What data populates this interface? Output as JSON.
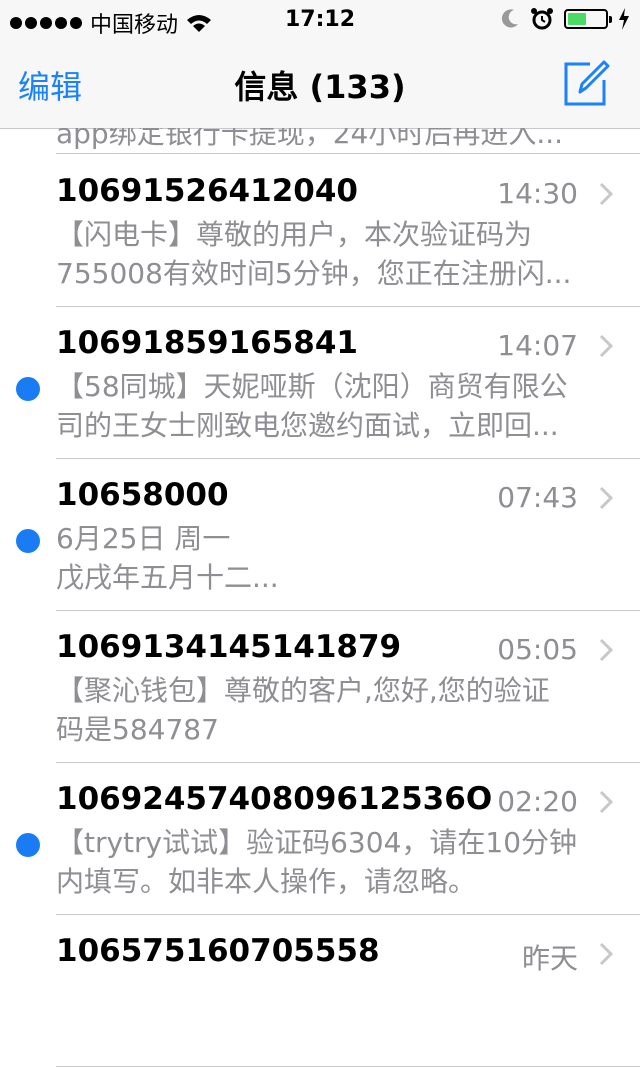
{
  "status_bar": {
    "carrier": "中国移动",
    "time": "17:12"
  },
  "nav": {
    "edit_label": "编辑",
    "title": "信息 (133)"
  },
  "clipped_preview": "app绑定银行卡提现，24小时后再进入...",
  "messages": [
    {
      "sender": "10691526412040",
      "time": "14:30",
      "line1": "【闪电卡】尊敬的用户，本次验证码为",
      "line2": "755008有效时间5分钟，您正在注册闪...",
      "unread": false
    },
    {
      "sender": "10691859165841",
      "time": "14:07",
      "line1": "【58同城】天妮哑斯（沈阳）商贸有限公",
      "line2": "司的王女士刚致电您邀约面试，立即回...",
      "unread": true
    },
    {
      "sender": "10658000",
      "time": "07:43",
      "line1": "6月25日 周一",
      "line2": "戊戌年五月十二...",
      "unread": true
    },
    {
      "sender": "1069134145141879",
      "time": "05:05",
      "line1": "【聚沁钱包】尊敬的客户,您好,您的验证",
      "line2": "码是584787",
      "unread": false
    },
    {
      "sender": "1069245740809612536O",
      "time": "02:20",
      "line1": "【trytry试试】验证码6304，请在10分钟",
      "line2": "内填写。如非本人操作，请忽略。",
      "unread": true
    },
    {
      "sender": "106575160705558",
      "time": "昨天",
      "line1": "",
      "line2": "",
      "unread": false
    }
  ]
}
